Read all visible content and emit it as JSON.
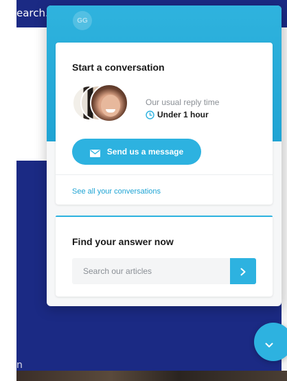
{
  "background": {
    "search_fragment": "earch..",
    "corner_fragment": "n"
  },
  "header": {
    "team_initials": "GG"
  },
  "conversation_card": {
    "title": "Start a conversation",
    "reply_time_label": "Our usual reply time",
    "reply_time_value": "Under 1 hour",
    "send_button_label": "Send us a message",
    "see_all_link": "See all your conversations"
  },
  "answer_card": {
    "title": "Find your answer now",
    "search_placeholder": "Search our articles"
  },
  "colors": {
    "accent": "#2db2e0",
    "host_navy": "#1b2a84",
    "link": "#1fa4d4"
  },
  "icons": {
    "clock": "clock-icon",
    "envelope": "envelope-icon",
    "search_submit": "chevron-right-icon",
    "launcher": "chevron-down-icon"
  }
}
